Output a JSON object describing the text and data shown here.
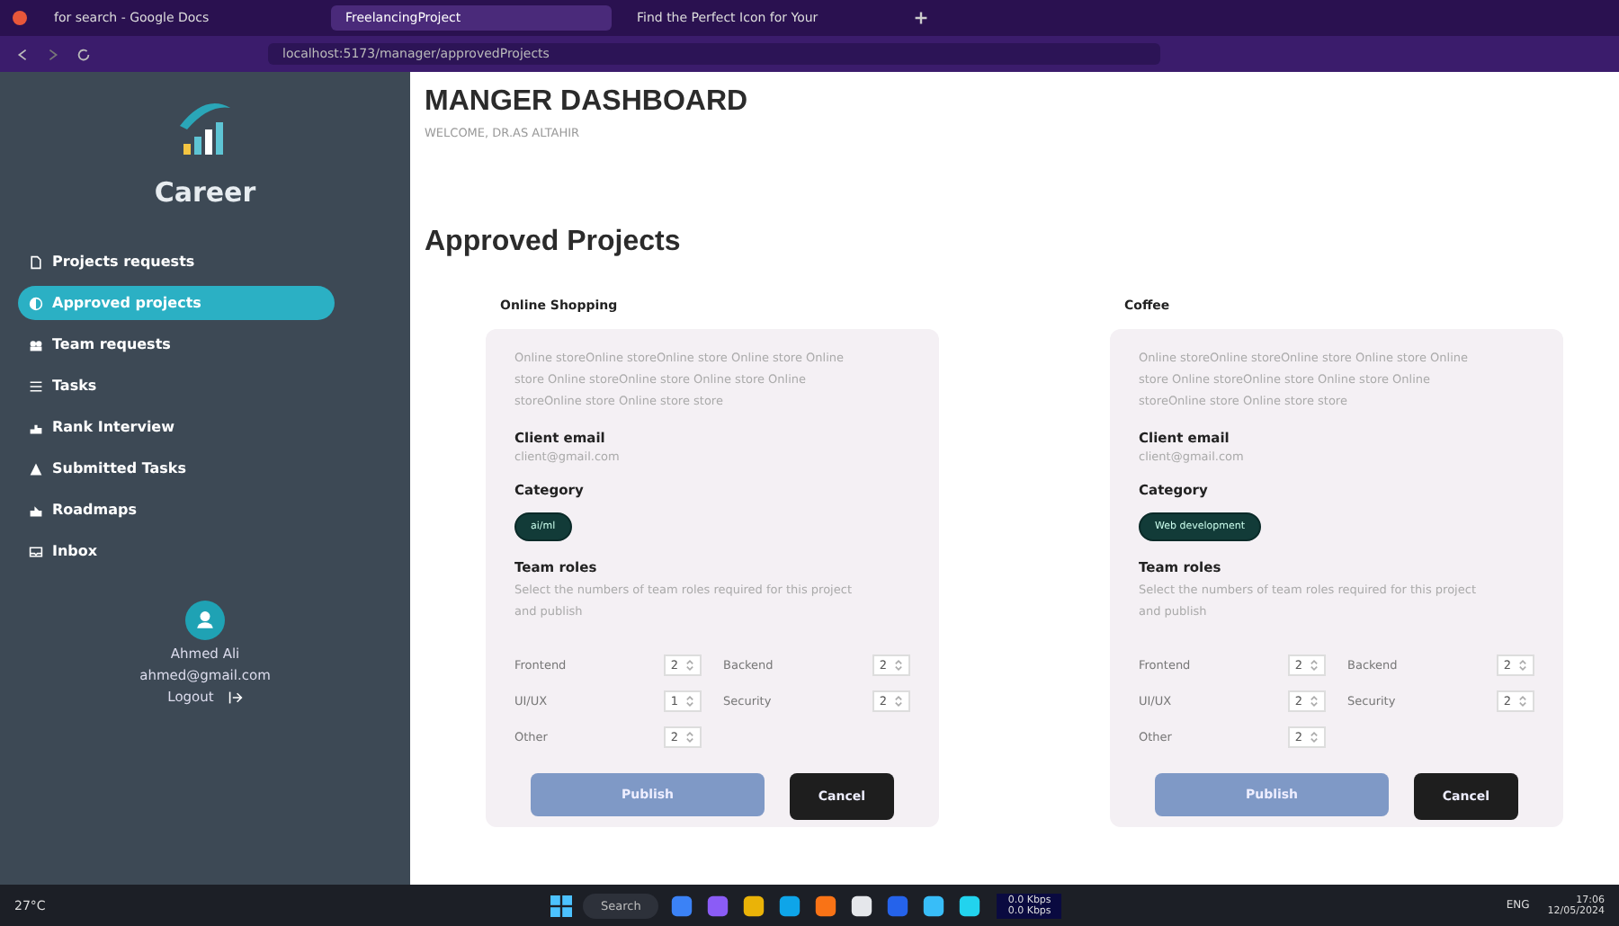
{
  "browser": {
    "tabs": [
      {
        "title": "for search - Google Docs",
        "selected": false
      },
      {
        "title": "FreelancingProject",
        "selected": true
      },
      {
        "title": "Find the Perfect Icon for Your",
        "selected": false
      }
    ],
    "address": "localhost:5173/manager/approvedProjects"
  },
  "sidebar": {
    "brand": "Career",
    "items": [
      {
        "label": "Projects requests",
        "selected": false
      },
      {
        "label": "Approved projects",
        "selected": true
      },
      {
        "label": "Team requests",
        "selected": false
      },
      {
        "label": "Tasks",
        "selected": false
      },
      {
        "label": "Rank Interview",
        "selected": false
      },
      {
        "label": "Submitted Tasks",
        "selected": false
      },
      {
        "label": "Roadmaps",
        "selected": false
      },
      {
        "label": "Inbox",
        "selected": false
      }
    ],
    "user": {
      "name": "Ahmed Ali",
      "email": "ahmed@gmail.com",
      "logout": "Logout"
    }
  },
  "header": {
    "title": "MANGER DASHBOARD",
    "welcome": "WELCOME, DR.AS ALTAHIR"
  },
  "section_title": "Approved Projects",
  "projects": [
    {
      "name": "Online Shopping",
      "description": "Online storeOnline storeOnline store Online store Online store Online storeOnline store Online store Online storeOnline store Online store store",
      "email_label": "Client email",
      "email": "client@gmail.com",
      "category_label": "Category",
      "category": "ai/ml",
      "roles_label": "Team roles",
      "roles_hint": "Select the numbers of team roles required for this project and publish",
      "roles": [
        {
          "label": "Frontend",
          "value": "2"
        },
        {
          "label": "Backend",
          "value": "2"
        },
        {
          "label": "UI/UX",
          "value": "1"
        },
        {
          "label": "Security",
          "value": "2"
        },
        {
          "label": "Other",
          "value": "2"
        }
      ],
      "publish": "Publish",
      "cancel": "Cancel"
    },
    {
      "name": "Coffee",
      "description": "Online storeOnline storeOnline store Online store Online store Online storeOnline store Online store Online storeOnline store Online store store",
      "email_label": "Client email",
      "email": "client@gmail.com",
      "category_label": "Category",
      "category": "Web development",
      "roles_label": "Team roles",
      "roles_hint": "Select the numbers of team roles required for this project and publish",
      "roles": [
        {
          "label": "Frontend",
          "value": "2"
        },
        {
          "label": "Backend",
          "value": "2"
        },
        {
          "label": "UI/UX",
          "value": "2"
        },
        {
          "label": "Security",
          "value": "2"
        },
        {
          "label": "Other",
          "value": "2"
        }
      ],
      "publish": "Publish",
      "cancel": "Cancel"
    }
  ],
  "taskbar": {
    "weather": "27°C",
    "search": "Search",
    "network_up": "0.0 Kbps",
    "network_down": "0.0 Kbps",
    "language": "ENG",
    "time": "17:06",
    "date": "12/05/2024"
  }
}
